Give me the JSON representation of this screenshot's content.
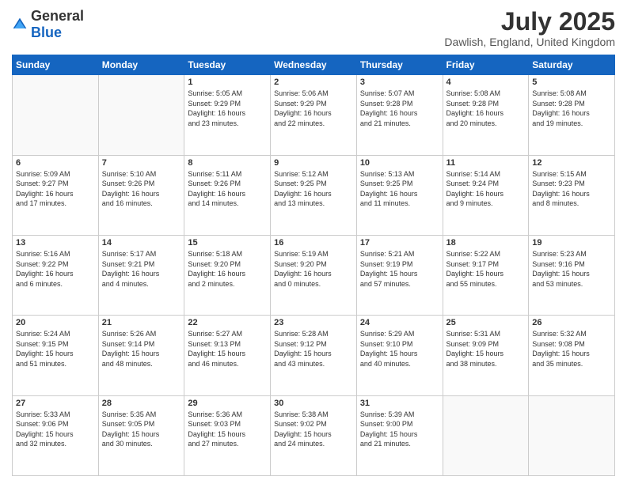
{
  "logo": {
    "general": "General",
    "blue": "Blue"
  },
  "title": "July 2025",
  "location": "Dawlish, England, United Kingdom",
  "days_of_week": [
    "Sunday",
    "Monday",
    "Tuesday",
    "Wednesday",
    "Thursday",
    "Friday",
    "Saturday"
  ],
  "weeks": [
    [
      {
        "day": "",
        "info": ""
      },
      {
        "day": "",
        "info": ""
      },
      {
        "day": "1",
        "info": "Sunrise: 5:05 AM\nSunset: 9:29 PM\nDaylight: 16 hours\nand 23 minutes."
      },
      {
        "day": "2",
        "info": "Sunrise: 5:06 AM\nSunset: 9:29 PM\nDaylight: 16 hours\nand 22 minutes."
      },
      {
        "day": "3",
        "info": "Sunrise: 5:07 AM\nSunset: 9:28 PM\nDaylight: 16 hours\nand 21 minutes."
      },
      {
        "day": "4",
        "info": "Sunrise: 5:08 AM\nSunset: 9:28 PM\nDaylight: 16 hours\nand 20 minutes."
      },
      {
        "day": "5",
        "info": "Sunrise: 5:08 AM\nSunset: 9:28 PM\nDaylight: 16 hours\nand 19 minutes."
      }
    ],
    [
      {
        "day": "6",
        "info": "Sunrise: 5:09 AM\nSunset: 9:27 PM\nDaylight: 16 hours\nand 17 minutes."
      },
      {
        "day": "7",
        "info": "Sunrise: 5:10 AM\nSunset: 9:26 PM\nDaylight: 16 hours\nand 16 minutes."
      },
      {
        "day": "8",
        "info": "Sunrise: 5:11 AM\nSunset: 9:26 PM\nDaylight: 16 hours\nand 14 minutes."
      },
      {
        "day": "9",
        "info": "Sunrise: 5:12 AM\nSunset: 9:25 PM\nDaylight: 16 hours\nand 13 minutes."
      },
      {
        "day": "10",
        "info": "Sunrise: 5:13 AM\nSunset: 9:25 PM\nDaylight: 16 hours\nand 11 minutes."
      },
      {
        "day": "11",
        "info": "Sunrise: 5:14 AM\nSunset: 9:24 PM\nDaylight: 16 hours\nand 9 minutes."
      },
      {
        "day": "12",
        "info": "Sunrise: 5:15 AM\nSunset: 9:23 PM\nDaylight: 16 hours\nand 8 minutes."
      }
    ],
    [
      {
        "day": "13",
        "info": "Sunrise: 5:16 AM\nSunset: 9:22 PM\nDaylight: 16 hours\nand 6 minutes."
      },
      {
        "day": "14",
        "info": "Sunrise: 5:17 AM\nSunset: 9:21 PM\nDaylight: 16 hours\nand 4 minutes."
      },
      {
        "day": "15",
        "info": "Sunrise: 5:18 AM\nSunset: 9:20 PM\nDaylight: 16 hours\nand 2 minutes."
      },
      {
        "day": "16",
        "info": "Sunrise: 5:19 AM\nSunset: 9:20 PM\nDaylight: 16 hours\nand 0 minutes."
      },
      {
        "day": "17",
        "info": "Sunrise: 5:21 AM\nSunset: 9:19 PM\nDaylight: 15 hours\nand 57 minutes."
      },
      {
        "day": "18",
        "info": "Sunrise: 5:22 AM\nSunset: 9:17 PM\nDaylight: 15 hours\nand 55 minutes."
      },
      {
        "day": "19",
        "info": "Sunrise: 5:23 AM\nSunset: 9:16 PM\nDaylight: 15 hours\nand 53 minutes."
      }
    ],
    [
      {
        "day": "20",
        "info": "Sunrise: 5:24 AM\nSunset: 9:15 PM\nDaylight: 15 hours\nand 51 minutes."
      },
      {
        "day": "21",
        "info": "Sunrise: 5:26 AM\nSunset: 9:14 PM\nDaylight: 15 hours\nand 48 minutes."
      },
      {
        "day": "22",
        "info": "Sunrise: 5:27 AM\nSunset: 9:13 PM\nDaylight: 15 hours\nand 46 minutes."
      },
      {
        "day": "23",
        "info": "Sunrise: 5:28 AM\nSunset: 9:12 PM\nDaylight: 15 hours\nand 43 minutes."
      },
      {
        "day": "24",
        "info": "Sunrise: 5:29 AM\nSunset: 9:10 PM\nDaylight: 15 hours\nand 40 minutes."
      },
      {
        "day": "25",
        "info": "Sunrise: 5:31 AM\nSunset: 9:09 PM\nDaylight: 15 hours\nand 38 minutes."
      },
      {
        "day": "26",
        "info": "Sunrise: 5:32 AM\nSunset: 9:08 PM\nDaylight: 15 hours\nand 35 minutes."
      }
    ],
    [
      {
        "day": "27",
        "info": "Sunrise: 5:33 AM\nSunset: 9:06 PM\nDaylight: 15 hours\nand 32 minutes."
      },
      {
        "day": "28",
        "info": "Sunrise: 5:35 AM\nSunset: 9:05 PM\nDaylight: 15 hours\nand 30 minutes."
      },
      {
        "day": "29",
        "info": "Sunrise: 5:36 AM\nSunset: 9:03 PM\nDaylight: 15 hours\nand 27 minutes."
      },
      {
        "day": "30",
        "info": "Sunrise: 5:38 AM\nSunset: 9:02 PM\nDaylight: 15 hours\nand 24 minutes."
      },
      {
        "day": "31",
        "info": "Sunrise: 5:39 AM\nSunset: 9:00 PM\nDaylight: 15 hours\nand 21 minutes."
      },
      {
        "day": "",
        "info": ""
      },
      {
        "day": "",
        "info": ""
      }
    ]
  ]
}
